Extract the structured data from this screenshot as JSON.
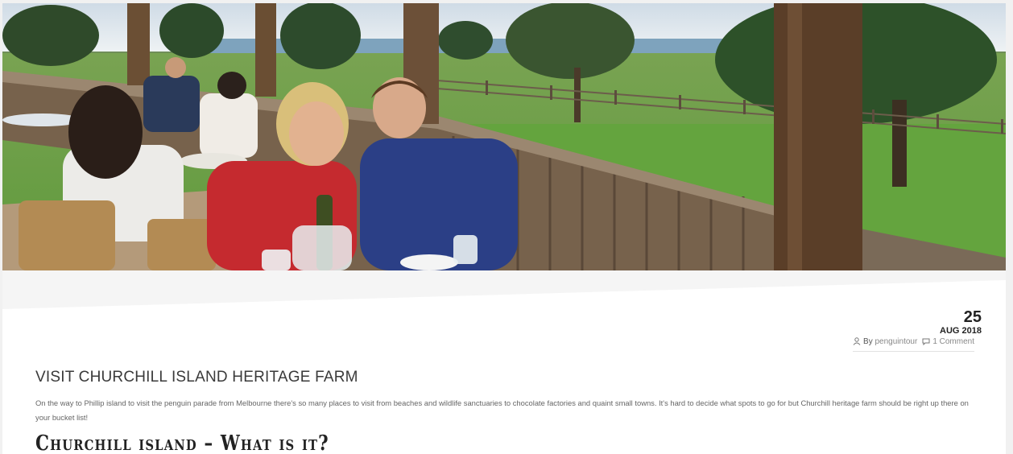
{
  "post": {
    "date_day": "25",
    "date_month": "AUG 2018",
    "by_label": "By",
    "author": "penguintour",
    "comments": "1 Comment",
    "title": "VISIT CHURCHILL ISLAND HERITAGE FARM",
    "body": "On the way to Phillip island to visit the penguin parade from Melbourne there's so many places to visit from beaches and wildlife sanctuaries to chocolate factories and quaint small towns. It's hard to decide what spots to go for but Churchill heritage farm should be right up there on your bucket list!",
    "subheading": "Churchill island – What is it?"
  },
  "icons": {
    "author": "user-icon",
    "comments": "speech-bubble-icon"
  },
  "colors": {
    "card_bg": "#ffffff",
    "page_bg": "#f1f1f1",
    "title_text": "#3a3a3a",
    "body_text": "#666666",
    "meta_link": "#888888"
  }
}
